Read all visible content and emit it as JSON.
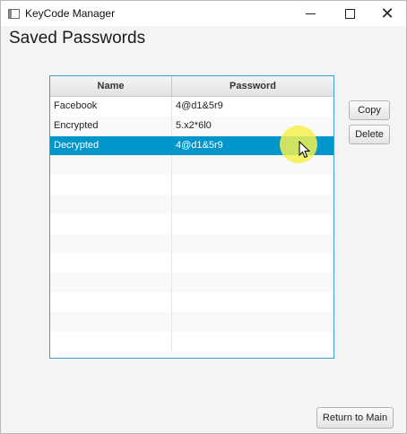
{
  "window": {
    "title": "KeyCode Manager",
    "controls": [
      "minimize",
      "maximize",
      "close"
    ]
  },
  "page": {
    "heading": "Saved Passwords"
  },
  "table": {
    "columns": [
      "Name",
      "Password"
    ],
    "rows": [
      {
        "name": "Facebook",
        "password": "4@d1&5r9",
        "selected": false
      },
      {
        "name": "Encrypted",
        "password": "5.x2*6l0",
        "selected": false
      },
      {
        "name": "Decrypted",
        "password": "4@d1&5r9",
        "selected": true
      }
    ],
    "selected_color": "#0096c9",
    "border_color": "#3d9bd6"
  },
  "actions": {
    "copy_label": "Copy",
    "delete_label": "Delete",
    "return_label": "Return to Main"
  }
}
